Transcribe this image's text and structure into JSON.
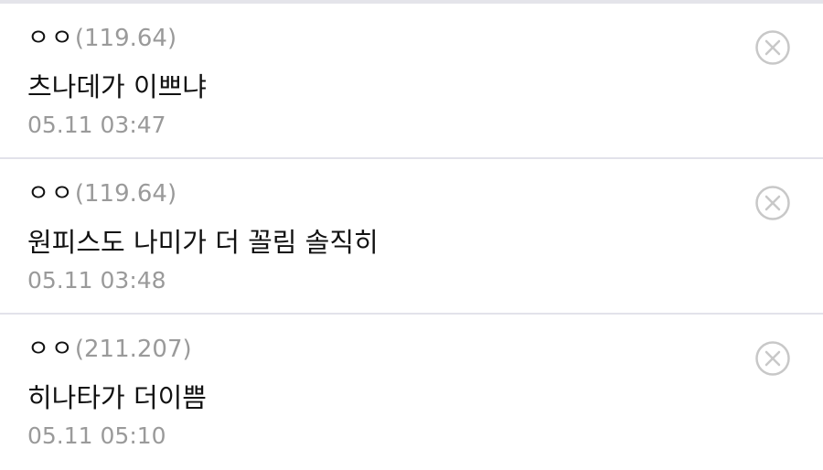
{
  "comments": [
    {
      "nickname": "ㅇㅇ",
      "ip": "(119.64)",
      "text": "츠나데가 이쁘냐",
      "timestamp": "05.11 03:47"
    },
    {
      "nickname": "ㅇㅇ",
      "ip": "(119.64)",
      "text": "원피스도 나미가 더 꼴림 솔직히",
      "timestamp": "05.11 03:48"
    },
    {
      "nickname": "ㅇㅇ",
      "ip": "(211.207)",
      "text": "히나타가 더이쁨",
      "timestamp": "05.11 05:10"
    }
  ],
  "icons": {
    "delete": "close-circle-icon"
  },
  "colors": {
    "text": "#111111",
    "muted": "#9a9a9a",
    "divider": "#e2e2ea",
    "icon": "#c8c8c8"
  }
}
